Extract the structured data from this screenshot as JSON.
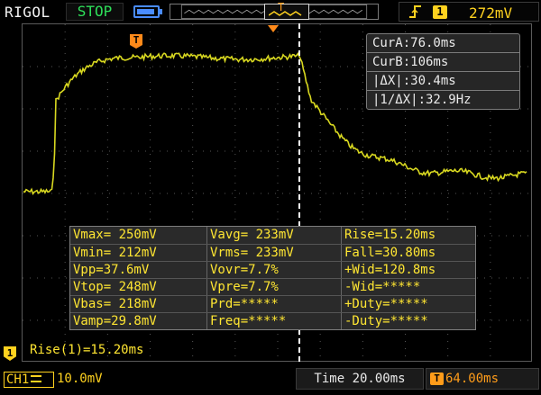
{
  "top": {
    "brand": "RIGOL",
    "run_status": "STOP",
    "trigger_channel": "1",
    "trigger_level": "272mV"
  },
  "icons": {
    "trigger_edge": "rising-edge-icon",
    "battery": "battery-icon",
    "trigger_marker": "T",
    "channel_marker": "1"
  },
  "cursor_box": {
    "cur_a": "CurA:76.0ms",
    "cur_b": "CurB:106ms",
    "delta_x": "|ΔX|:30.4ms",
    "inv_delta_x": "|1/ΔX|:32.9Hz"
  },
  "measurements": {
    "rows": [
      [
        "Vmax= 250mV",
        "Vavg= 233mV",
        "Rise=15.20ms"
      ],
      [
        "Vmin= 212mV",
        "Vrms= 233mV",
        "Fall=30.80ms"
      ],
      [
        "Vpp=37.6mV",
        "Vovr=7.7%",
        "+Wid=120.8ms"
      ],
      [
        "Vtop= 248mV",
        "Vpre=7.7%",
        "-Wid=*****"
      ],
      [
        "Vbas= 218mV",
        "Prd=*****",
        "+Duty=*****"
      ],
      [
        "Vamp=29.8mV",
        "Freq=*****",
        "-Duty=*****"
      ]
    ]
  },
  "rise_readout": "Rise(1)=15.20ms",
  "bottom": {
    "channel_label": "CH1",
    "channel_scale": "10.0mV",
    "timebase": "Time 20.00ms",
    "trigger_offset": "64.00ms"
  },
  "colors": {
    "trace": "#d8d820",
    "measure_text": "#ffe632",
    "run_status": "#2ee05a",
    "trigger": "#ff9c1a",
    "channel": "#ffd21f",
    "battery": "#4a8cff"
  }
}
